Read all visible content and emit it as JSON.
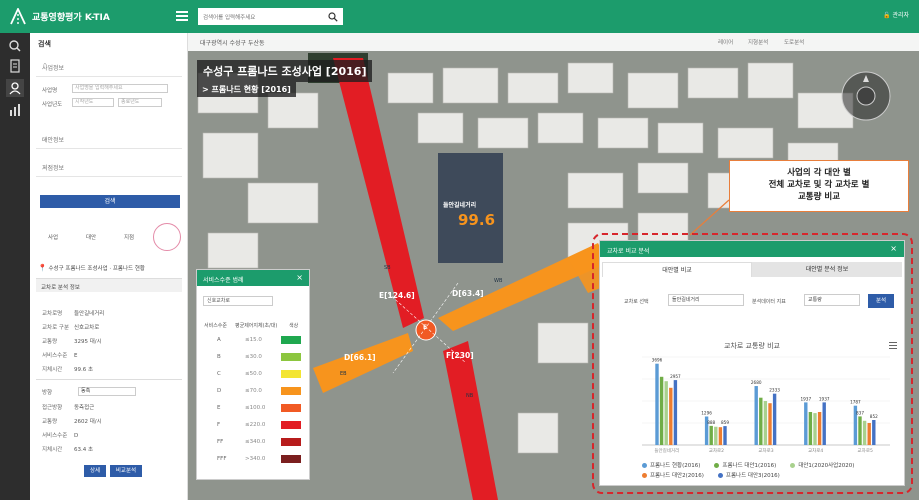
{
  "app": {
    "title": "교통영향평가 K-TIA",
    "user_label": "관리자"
  },
  "search": {
    "placeholder": "검색어를 입력해주세요"
  },
  "left_panel": {
    "title": "검색",
    "section_business": "사업정보",
    "field_labels": [
      "사업명",
      "사업년도"
    ],
    "field_placeholders": [
      "사업명을 입력해주세요",
      "시작년도",
      "종료년도"
    ],
    "section_alternative": "대안정보",
    "section_location": "지점정보",
    "search_button": "검색",
    "modes": [
      "사업",
      "대안",
      "지점"
    ],
    "location_text": "수성구 프롬나드 조성사업 · 프롬나드 현황",
    "result_header": "교차로 분석 정보",
    "result_rows": [
      {
        "label": "교차로명",
        "value": "들안길네거리"
      },
      {
        "label": "교차로 구분",
        "value": "신호교차로"
      },
      {
        "label": "교통량",
        "value": "3295 대/시"
      },
      {
        "label": "서비스수준",
        "value": "E"
      },
      {
        "label": "지체시간",
        "value": "99.6 초"
      }
    ],
    "sub_rows_label": "방향",
    "sub_select": "동측",
    "sub_rows": [
      {
        "label": "접근방향",
        "value": "동측접근"
      },
      {
        "label": "교통량",
        "value": "2602 대/시"
      },
      {
        "label": "서비스수준",
        "value": "D"
      },
      {
        "label": "지체시간",
        "value": "63.4 초"
      }
    ],
    "btn_detail": "상세",
    "btn_compare": "비교분석"
  },
  "map": {
    "breadcrumb": "대구광역시 수성구 두산동",
    "tools": [
      "레이어",
      "지형분석",
      "도로분석"
    ],
    "title": "수성구 프롬나드 조성사업 [2016]",
    "subtitle": "> 프롬나드 현황 [2016]",
    "intersection_name": "들안길네거리",
    "delay_value": "99.6",
    "approach_labels": [
      "E[124.6]",
      "D[63.4]",
      "F[230]",
      "D[66.1]"
    ],
    "road_codes": [
      "SB",
      "WB",
      "EB",
      "NB"
    ],
    "center_grade": "E"
  },
  "callout": {
    "line1": "사업의 각 대안 별",
    "line2": "전체 교차로 및 각 교차로 별",
    "line3": "교통량 비교"
  },
  "service_popup": {
    "title": "서비스수준 범례",
    "select_value": "신호교차로",
    "headers": [
      "서비스수준",
      "평균제어지체(초/대)",
      "색상"
    ],
    "rows": [
      {
        "grade": "A",
        "range": "≤15.0",
        "color": "#1fa84f"
      },
      {
        "grade": "B",
        "range": "≤30.0",
        "color": "#8cc63f"
      },
      {
        "grade": "C",
        "range": "≤50.0",
        "color": "#f3e532"
      },
      {
        "grade": "D",
        "range": "≤70.0",
        "color": "#f7941d"
      },
      {
        "grade": "E",
        "range": "≤100.0",
        "color": "#f15a24"
      },
      {
        "grade": "F",
        "range": "≤220.0",
        "color": "#e21d24"
      },
      {
        "grade": "FF",
        "range": "≤340.0",
        "color": "#b71c1c"
      },
      {
        "grade": "FFF",
        "range": ">340.0",
        "color": "#7b1f1f"
      }
    ]
  },
  "compare_panel": {
    "title": "교차로 비교 분석",
    "tabs": [
      "대안별 비교",
      "대안별 분석 정보"
    ],
    "label_crossroad": "교차로 선택",
    "select_crossroad": "들안길네거리",
    "label_analysis": "분석데이터 지표",
    "select_analysis": "교통량",
    "button": "분석",
    "chart_title": "교차로 교통량 비교"
  },
  "chart_data": {
    "type": "bar",
    "title": "교차로 교통량 비교",
    "categories": [
      "들안길네거리",
      "교차로2",
      "교차로3",
      "교차로4",
      "교차로5"
    ],
    "ylim": [
      0,
      4000
    ],
    "series": [
      {
        "name": "프롬나드 현황(2016)",
        "color": "#5b9bd5",
        "values": [
          3696,
          1296,
          2680,
          1937,
          1787
        ]
      },
      {
        "name": "프롬나드 대안1(2016)",
        "color": "#70ad47",
        "values": [
          3100,
          870,
          2150,
          1500,
          1300
        ]
      },
      {
        "name": "대안1(2020사업2020)",
        "color": "#a9d18e",
        "values": [
          2900,
          830,
          2000,
          1450,
          1100
        ]
      },
      {
        "name": "프롬나드 대안2(2016)",
        "color": "#ed7d31",
        "values": [
          2600,
          810,
          1900,
          1500,
          1000
        ]
      },
      {
        "name": "프롬나드 대안3(2016)",
        "color": "#4472c4",
        "values": [
          2950,
          859,
          2333,
          1937,
          1136
        ]
      }
    ],
    "data_labels": [
      "3696",
      "2957",
      "1296",
      "888",
      "859",
      "2680",
      "2333",
      "1937",
      "1937",
      "1787",
      "837",
      "852"
    ],
    "legend": "bottom"
  }
}
